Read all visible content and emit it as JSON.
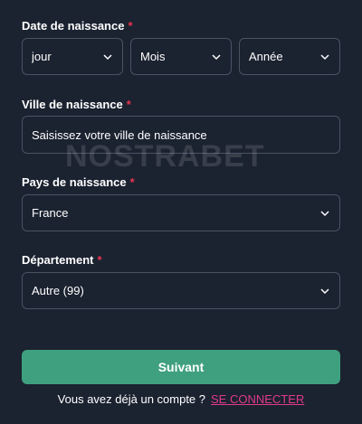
{
  "form": {
    "birth_date": {
      "label": "Date de naissance",
      "required_mark": "*",
      "day": "jour",
      "month": "Mois",
      "year": "Année"
    },
    "birth_city": {
      "label": "Ville de naissance",
      "required_mark": "*",
      "placeholder": "Saisissez votre ville de naissance"
    },
    "birth_country": {
      "label": "Pays de naissance",
      "required_mark": "*",
      "value": "France"
    },
    "department": {
      "label": "Département",
      "required_mark": "*",
      "value": "Autre (99)"
    },
    "submit_label": "Suivant",
    "login_prompt": "Vous avez déjà un compte ?",
    "login_link": "SE CONNECTER"
  },
  "watermark": "NOSTRABET",
  "colors": {
    "background": "#1b2230",
    "required": "#e8344e",
    "button": "#3fa07f",
    "link": "#e03a8a"
  },
  "icons": [
    "chevron-down-icon"
  ]
}
